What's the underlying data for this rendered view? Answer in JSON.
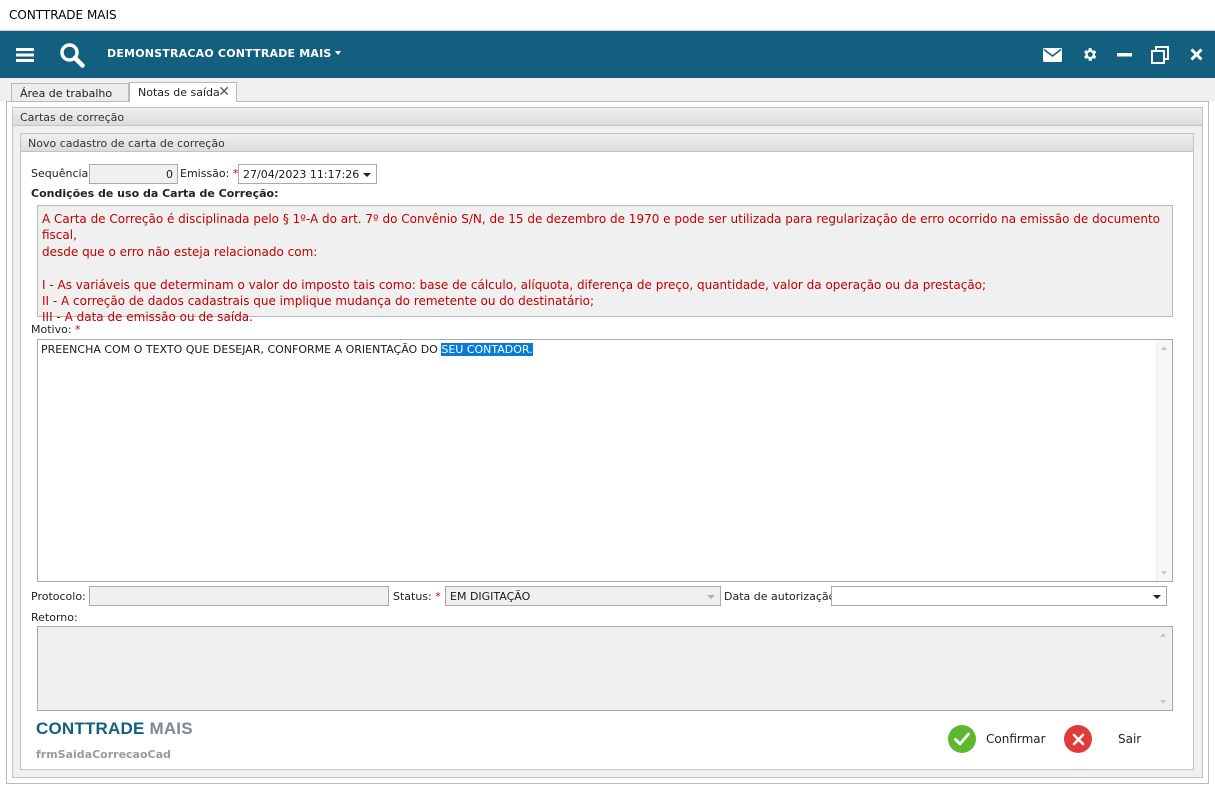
{
  "window": {
    "title": "CONTTRADE MAIS"
  },
  "navbar": {
    "company": "DEMONSTRACAO CONTTRADE MAIS",
    "color": "#135f80",
    "icons_left": [
      "menu-icon",
      "search-icon"
    ],
    "icons_right": [
      "mail-icon",
      "gear-icon",
      "minimize-icon",
      "restore-icon",
      "close-icon"
    ]
  },
  "tabs": [
    {
      "label": "Área de trabalho",
      "active": false
    },
    {
      "label": "Notas de saída",
      "active": true,
      "closable": true
    }
  ],
  "panel": {
    "title": "Cartas de correção",
    "subtitle": "Novo cadastro de carta de correção"
  },
  "form": {
    "sequencia": {
      "label": "Sequência:",
      "value": "0"
    },
    "emissao": {
      "label": "Emissão:",
      "required_mark": "*",
      "value": "27/04/2023 11:17:26"
    },
    "conditions": {
      "title": "Condições de uso da Carta de Correção:",
      "text_color": "#c00000",
      "lines": [
        "A Carta de Correção é disciplinada pelo § 1º-A do art. 7º do Convênio S/N, de 15 de dezembro de 1970 e pode ser utilizada para regularização de erro ocorrido na emissão de documento fiscal,",
        "desde que o erro não esteja relacionado com:",
        "",
        "I - As variáveis que determinam o valor do imposto tais como: base de cálculo, alíquota, diferença de preço, quantidade, valor da operação ou da prestação;",
        "II - A correção de dados cadastrais que implique mudança do remetente ou do destinatário;",
        "III - A data de emissão ou de saída."
      ]
    },
    "motivo": {
      "label": "Motivo:",
      "required_mark": "*",
      "value_part1": "PREENCHA COM O TEXTO QUE DESEJAR, CONFORME A ORIENTAÇÃO DO ",
      "value_selected": "SEU CONTADOR."
    },
    "protocolo": {
      "label": "Protocolo:",
      "value": ""
    },
    "status": {
      "label": "Status:",
      "required_mark": "*",
      "value": "EM DIGITAÇÃO"
    },
    "data_autorizacao": {
      "label": "Data de autorização:",
      "value": ""
    },
    "retorno": {
      "label": "Retorno:",
      "value": ""
    }
  },
  "footer": {
    "brand_part1": "CONTTRADE",
    "brand_part2": "MAIS",
    "form_name": "frmSaidaCorrecaoCad",
    "confirm_label": "Confirmar",
    "exit_label": "Sair",
    "confirm_color": "#5cb82e",
    "exit_color": "#e03a3a"
  }
}
